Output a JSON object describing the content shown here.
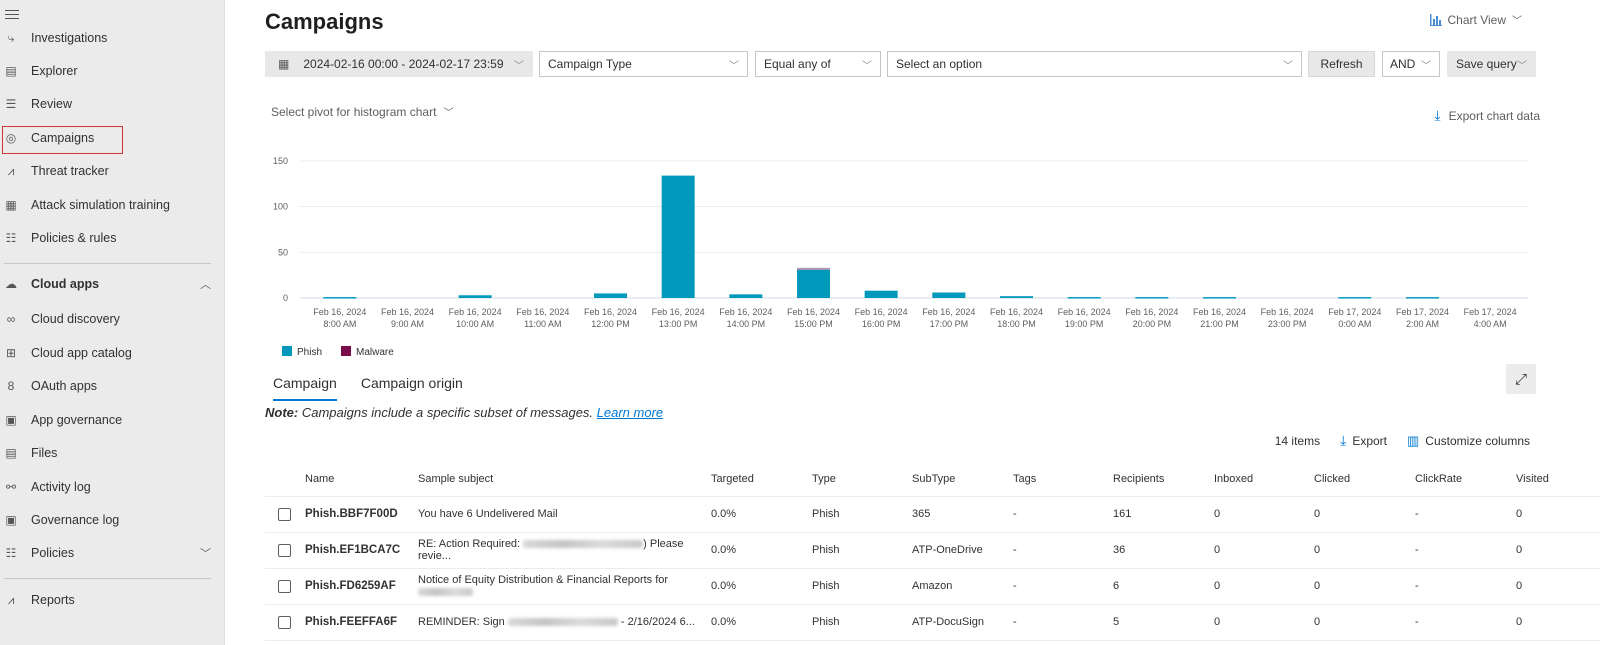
{
  "sidebar": {
    "items": [
      {
        "label": "Investigations",
        "icon": "investigation-icon"
      },
      {
        "label": "Explorer",
        "icon": "explorer-icon"
      },
      {
        "label": "Review",
        "icon": "review-icon"
      },
      {
        "label": "Campaigns",
        "icon": "target-icon",
        "selected": true
      },
      {
        "label": "Threat tracker",
        "icon": "chart-line-icon"
      },
      {
        "label": "Attack simulation training",
        "icon": "simulation-icon"
      },
      {
        "label": "Policies & rules",
        "icon": "sliders-icon"
      }
    ],
    "cloud_apps": {
      "label": "Cloud apps",
      "items": [
        {
          "label": "Cloud discovery",
          "icon": "binoculars-icon"
        },
        {
          "label": "Cloud app catalog",
          "icon": "catalog-icon"
        },
        {
          "label": "OAuth apps",
          "icon": "oauth-icon"
        },
        {
          "label": "App governance",
          "icon": "clipboard-icon"
        },
        {
          "label": "Files",
          "icon": "file-search-icon"
        },
        {
          "label": "Activity log",
          "icon": "glasses-icon"
        },
        {
          "label": "Governance log",
          "icon": "clipboard-icon"
        },
        {
          "label": "Policies",
          "icon": "sliders-icon"
        }
      ]
    },
    "reports": {
      "label": "Reports",
      "icon": "chart-line-icon"
    }
  },
  "header": {
    "title": "Campaigns",
    "chart_view": "Chart View"
  },
  "filters": {
    "date_range": "2024-02-16 00:00 - 2024-02-17 23:59",
    "field": "Campaign Type",
    "operator": "Equal any of",
    "value_placeholder": "Select an option",
    "refresh": "Refresh",
    "logic": "AND",
    "save_query": "Save query"
  },
  "pivot_label": "Select pivot for histogram chart",
  "export_chart": "Export chart data",
  "colors": {
    "phish": "#0099bc",
    "malware": "#7a0c4a",
    "accent": "#0078d4"
  },
  "chart_data": {
    "type": "bar",
    "stacked": true,
    "categories": [
      [
        "Feb 16, 2024",
        "8:00 AM"
      ],
      [
        "Feb 16, 2024",
        "9:00 AM"
      ],
      [
        "Feb 16, 2024",
        "10:00 AM"
      ],
      [
        "Feb 16, 2024",
        "11:00 AM"
      ],
      [
        "Feb 16, 2024",
        "12:00 PM"
      ],
      [
        "Feb 16, 2024",
        "13:00 PM"
      ],
      [
        "Feb 16, 2024",
        "14:00 PM"
      ],
      [
        "Feb 16, 2024",
        "15:00 PM"
      ],
      [
        "Feb 16, 2024",
        "16:00 PM"
      ],
      [
        "Feb 16, 2024",
        "17:00 PM"
      ],
      [
        "Feb 16, 2024",
        "18:00 PM"
      ],
      [
        "Feb 16, 2024",
        "19:00 PM"
      ],
      [
        "Feb 16, 2024",
        "20:00 PM"
      ],
      [
        "Feb 16, 2024",
        "21:00 PM"
      ],
      [
        "Feb 16, 2024",
        "23:00 PM"
      ],
      [
        "Feb 17, 2024",
        "0:00 AM"
      ],
      [
        "Feb 17, 2024",
        "2:00 AM"
      ],
      [
        "Feb 17, 2024",
        "4:00 AM"
      ]
    ],
    "series": [
      {
        "name": "Phish",
        "values": [
          1,
          0,
          3,
          0,
          5,
          134,
          4,
          31,
          8,
          6,
          2,
          1,
          1,
          1,
          0,
          1,
          1,
          0
        ]
      },
      {
        "name": "Malware",
        "values": [
          0,
          0,
          0,
          0,
          0,
          0,
          0,
          2,
          0,
          0,
          0,
          0,
          0,
          0,
          0,
          0,
          0,
          0
        ]
      }
    ],
    "yticks": [
      0,
      50,
      100,
      150
    ],
    "ylim": [
      0,
      150
    ],
    "grid": true,
    "legend": "bottom-left",
    "title": "",
    "xlabel": "",
    "ylabel": ""
  },
  "tabs": [
    {
      "label": "Campaign",
      "active": true
    },
    {
      "label": "Campaign origin",
      "active": false
    }
  ],
  "note": {
    "prefix": "Note:",
    "text": " Campaigns include a specific subset of messages. ",
    "link": "Learn more"
  },
  "table_tools": {
    "count": "14 items",
    "export": "Export",
    "customize": "Customize columns"
  },
  "table": {
    "columns": [
      "Name",
      "Sample subject",
      "Targeted",
      "Type",
      "SubType",
      "Tags",
      "Recipients",
      "Inboxed",
      "Clicked",
      "ClickRate",
      "Visited"
    ],
    "rows": [
      {
        "name": "Phish.BBF7F00D",
        "subject_a": "You have 6 Undelivered Mail",
        "subject_b": "",
        "blur": 0,
        "targeted": "0.0%",
        "type": "Phish",
        "subtype": "365",
        "tags": "-",
        "recipients": "161",
        "inboxed": "0",
        "clicked": "0",
        "clickrate": "-",
        "visited": "0"
      },
      {
        "name": "Phish.EF1BCA7C",
        "subject_a": "RE: Action Required: ",
        "subject_b": ") Please revie...",
        "blur": 1,
        "targeted": "0.0%",
        "type": "Phish",
        "subtype": "ATP-OneDrive",
        "tags": "-",
        "recipients": "36",
        "inboxed": "0",
        "clicked": "0",
        "clickrate": "-",
        "visited": "0"
      },
      {
        "name": "Phish.FD6259AF",
        "subject_a": "Notice of Equity Distribution & Financial Reports for ",
        "subject_b": "",
        "blur": 2,
        "targeted": "0.0%",
        "type": "Phish",
        "subtype": "Amazon",
        "tags": "-",
        "recipients": "6",
        "inboxed": "0",
        "clicked": "0",
        "clickrate": "-",
        "visited": "0"
      },
      {
        "name": "Phish.FEEFFA6F",
        "subject_a": "REMINDER: Sign ",
        "subject_b": " - 2/16/2024 6...",
        "blur": 3,
        "targeted": "0.0%",
        "type": "Phish",
        "subtype": "ATP-DocuSign",
        "tags": "-",
        "recipients": "5",
        "inboxed": "0",
        "clicked": "0",
        "clickrate": "-",
        "visited": "0"
      }
    ]
  }
}
